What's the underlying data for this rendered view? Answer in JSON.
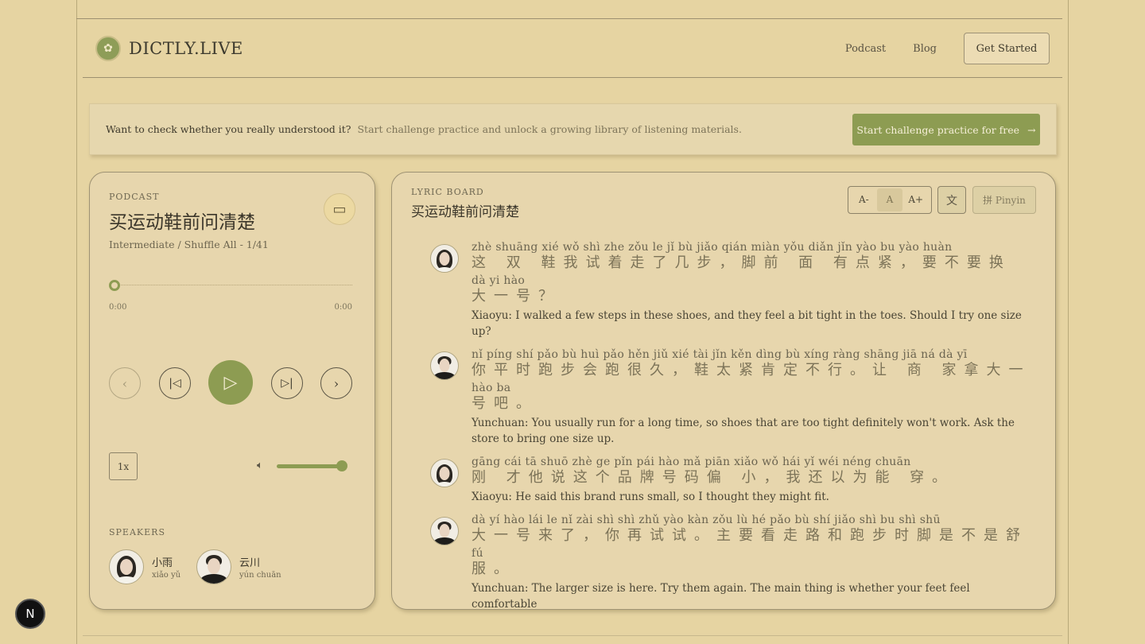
{
  "header": {
    "brand": "DICTLY.LIVE",
    "nav": [
      "Podcast",
      "Blog"
    ],
    "cta": "Get Started"
  },
  "banner": {
    "question": "Want to check whether you really understood it?",
    "subtext": "Start challenge practice and unlock a growing library of listening materials.",
    "button": "Start challenge practice for free",
    "button_icon": "arrow-right-icon"
  },
  "player": {
    "eyebrow": "PODCAST",
    "title": "买运动鞋前问清楚",
    "subtitle": "Intermediate / Shuffle All - 1/41",
    "time_current": "0:00",
    "time_total": "0:00",
    "progress": 0,
    "speed": "1x",
    "volume": 0.85,
    "speakers_label": "SPEAKERS",
    "speakers": [
      {
        "name": "小雨",
        "pinyin": "xiǎo yǔ"
      },
      {
        "name": "云川",
        "pinyin": "yún chuān"
      }
    ]
  },
  "lyric_board": {
    "eyebrow": "LYRIC BOARD",
    "title": "买运动鞋前问清楚",
    "font_controls": [
      "A-",
      "A",
      "A+"
    ],
    "pinyin_button": "拼 Pinyin",
    "lines": [
      {
        "speaker": "female",
        "rows": [
          {
            "py": "zhè shuāng xié wǒ shì zhe zǒu  le   jǐ  bù     jiǎo qián miàn yǒu diǎn jǐn      yào bu yào huàn",
            "zh": "这 双 鞋我试着走了几步，脚前 面 有点紧，要不要换"
          },
          {
            "py": "dà  yi  hào",
            "zh": "大一号？"
          }
        ],
        "en": "Xiaoyu: I walked a few steps in these shoes, and they feel a bit tight in the toes. Should I try one size up?"
      },
      {
        "speaker": "male",
        "rows": [
          {
            "py": " nǐ  píng shí pǎo bù huì pǎo hěn jiǔ     xié tài jǐn kěn dìng bù xíng   ràng shāng jiā ná dà  yī",
            "zh": "你平时跑步会跑很久，鞋太紧肯定不行。让 商 家拿大一"
          },
          {
            "py": "hào ba",
            "zh": "号吧。"
          }
        ],
        "en": "Yunchuan: You usually run for a long time, so shoes that are too tight definitely won't work. Ask the store to bring one size up."
      },
      {
        "speaker": "female",
        "rows": [
          {
            "py": "gāng cái  tā  shuō zhè  ge  pǐn pái hào mǎ piān xiǎo     wǒ hái  yǐ  wéi néng chuān",
            "zh": " 刚 才他说这个品牌号码偏 小，我还以为能 穿。"
          }
        ],
        "en": "Xiaoyu: He said this brand runs small, so I thought they might fit."
      },
      {
        "speaker": "male",
        "rows": [
          {
            "py": "dà  yí  hào lái  le      nǐ  zài shì shì     zhǔ yào kàn zǒu  lù  hé  pǎo bù  shí jiǎo shì bu shì shū",
            "zh": "大一号来了，你再试试。主要看走路和跑步时脚是不是舒"
          },
          {
            "py": "fú",
            "zh": "服。"
          }
        ],
        "en": "Yunchuan: The larger size is here. Try them again. The main thing is whether your feet feel comfortable"
      }
    ]
  },
  "colors": {
    "background": "#e6d4a2",
    "accent": "#8d9c52",
    "card": "#e7d6ad"
  },
  "icons": [
    "squirrel-logo-icon",
    "arrow-right-icon",
    "box-icon",
    "chevron-left-icon",
    "skip-back-icon",
    "play-icon",
    "skip-forward-icon",
    "chevron-right-icon",
    "volume-icon",
    "translate-icon"
  ]
}
